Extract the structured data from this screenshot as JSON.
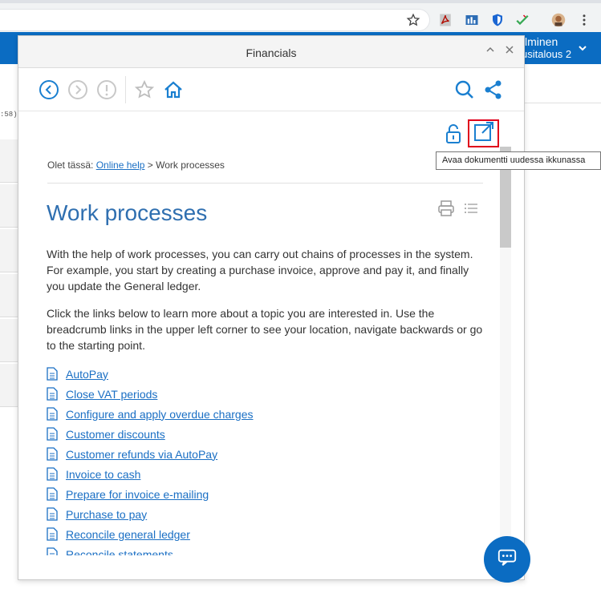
{
  "browser": {
    "bookmark_icon": "star-outline-icon",
    "extensions": [
      "acrobat-icon",
      "chart-extension-icon",
      "shield-icon",
      "checkmark-extension-icon"
    ],
    "menu_icon": "vertical-dots-icon"
  },
  "app_header": {
    "user_line1": "lminen",
    "user_line2": "usitalous 2",
    "accent_color": "#0b6cc2"
  },
  "background": {
    "timestamp_fragment": ":58)"
  },
  "panel": {
    "title": "Financials",
    "collapse_symbol": "⌃",
    "close_symbol": "✕"
  },
  "toolbar": {
    "back_icon": "arrow-left-circle-icon",
    "forward_icon": "arrow-right-circle-icon",
    "info_icon": "exclamation-circle-icon",
    "favorite_icon": "star-icon",
    "home_icon": "home-icon",
    "search_icon": "search-icon",
    "share_icon": "share-icon"
  },
  "document_actions": {
    "lock_icon": "unlock-icon",
    "open_new_window_icon": "external-link-icon",
    "tooltip": "Avaa dokumentti uudessa ikkunassa"
  },
  "breadcrumb": {
    "prefix": "Olet tässä:",
    "link": "Online help",
    "separator": ">",
    "current": "Work processes"
  },
  "content": {
    "heading": "Work processes",
    "paragraph1": "With the help of work processes, you can carry out chains of processes in the system. For example, you start by creating a purchase invoice, approve and pay it, and finally you update the General ledger.",
    "paragraph2": "Click the links below to learn more about a topic you are interested in. Use the breadcrumb links in the upper left corner to see your location, navigate backwards or go to the starting point.",
    "links": [
      "AutoPay",
      "Close VAT periods",
      "Configure and apply overdue charges",
      "Customer discounts",
      "Customer refunds via AutoPay",
      "Invoice to cash",
      "Prepare for invoice e-mailing",
      "Purchase to pay",
      "Reconcile general ledger",
      "Reconcile statements"
    ]
  },
  "chat": {
    "icon": "chat-bubble-icon"
  }
}
